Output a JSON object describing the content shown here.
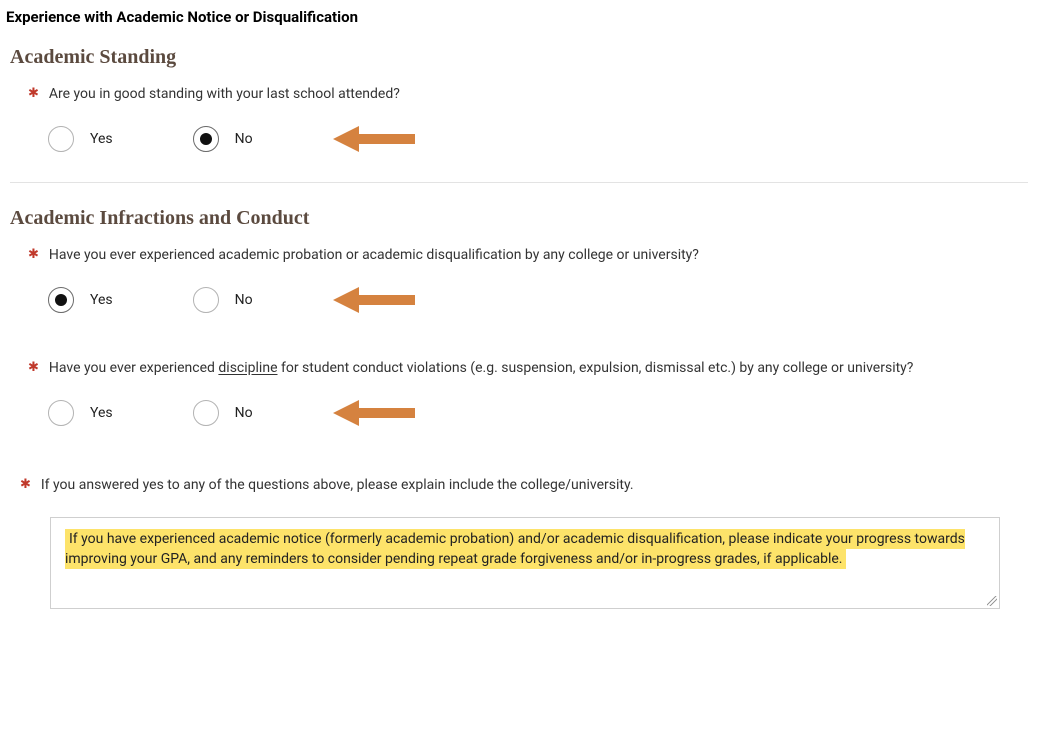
{
  "page": {
    "title": "Experience with Academic Notice or Disqualification"
  },
  "section1": {
    "heading": "Academic Standing",
    "q1": {
      "text": "Are you in good standing with your last school attended?",
      "optYes": "Yes",
      "optNo": "No",
      "selected": "No"
    }
  },
  "section2": {
    "heading": "Academic Infractions and Conduct",
    "q1": {
      "text": "Have you ever experienced academic probation or academic disqualification by any college or university?",
      "optYes": "Yes",
      "optNo": "No",
      "selected": "Yes"
    },
    "q2": {
      "prefix": "Have you ever experienced ",
      "underlined": "discipline",
      "suffix": " for student conduct violations (e.g. suspension, expulsion, dismissal etc.) by any college or university?",
      "optYes": "Yes",
      "optNo": "No",
      "selected": ""
    },
    "q3": {
      "text": "If you answered yes to any of the questions above, please explain include the college/university.",
      "textarea_value": "If you have experienced academic notice (formerly academic probation) and/or academic disqualification, please indicate your progress towards improving your GPA, and any reminders to consider pending repeat grade forgiveness and/or in-progress grades, if applicable."
    }
  },
  "colors": {
    "arrow": "#d5823f"
  }
}
